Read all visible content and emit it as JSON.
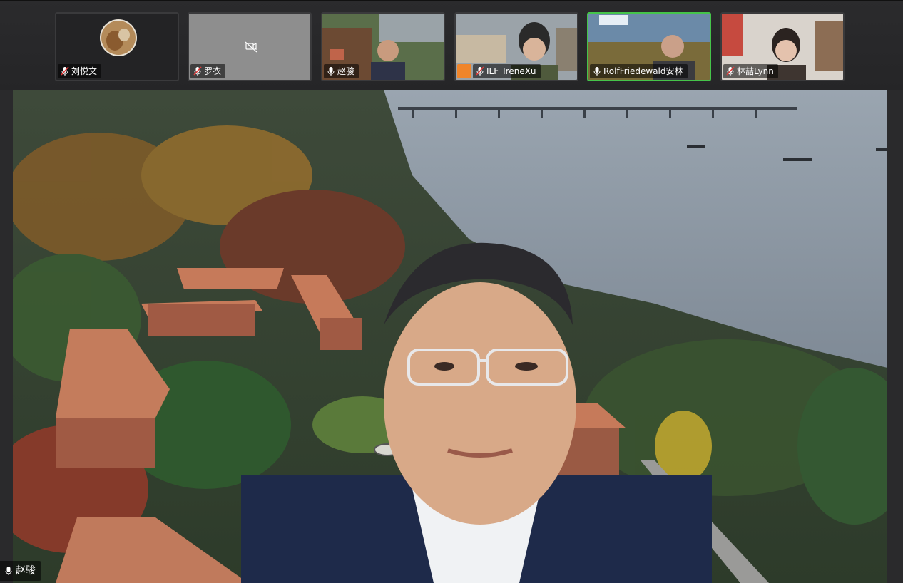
{
  "participants": [
    {
      "name": "刘悦文",
      "muted": true,
      "kind": "avatar"
    },
    {
      "name": "罗衣",
      "muted": true,
      "kind": "camera-off"
    },
    {
      "name": "赵骏",
      "muted": false,
      "kind": "video"
    },
    {
      "name": "ILF_IreneXu",
      "muted": true,
      "kind": "video",
      "has_badge": true
    },
    {
      "name": "RolfFriedewald安林",
      "muted": false,
      "kind": "video",
      "active": true
    },
    {
      "name": "林喆Lynn",
      "muted": true,
      "kind": "video"
    }
  ],
  "active_speaker": {
    "name": "赵骏",
    "muted": false
  },
  "colors": {
    "active_border": "#45c44a",
    "badge": "#f0852a"
  }
}
